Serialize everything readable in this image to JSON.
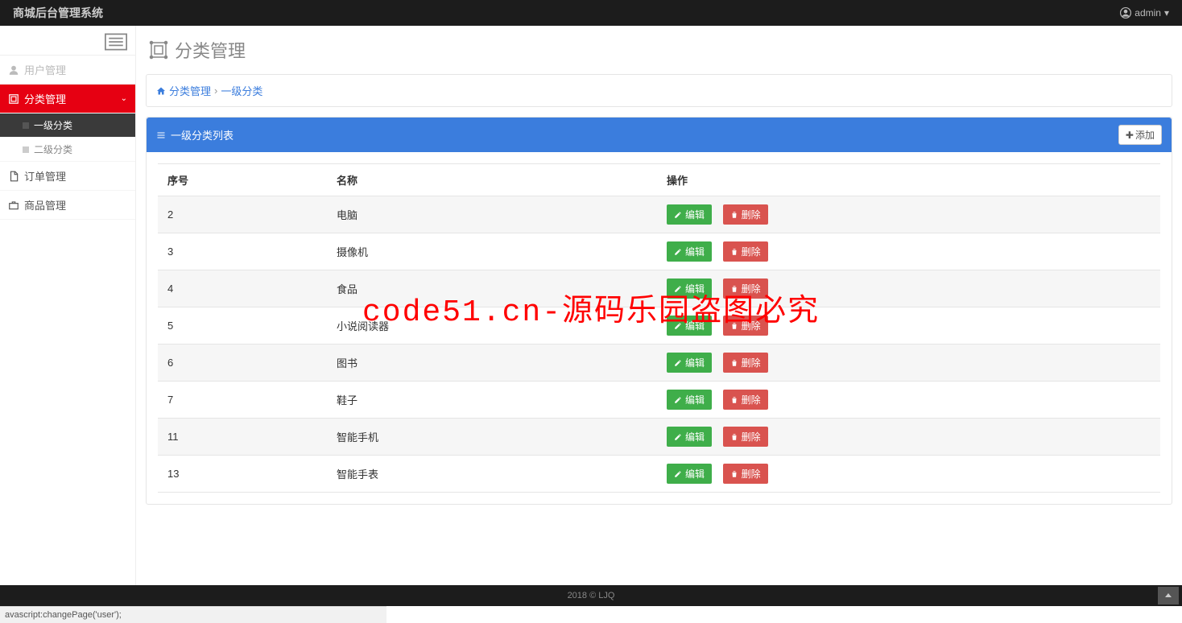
{
  "topbar": {
    "brand": "商城后台管理系统",
    "user": "admin"
  },
  "sidebar": {
    "items": [
      {
        "label": "用户管理",
        "kind": "muted"
      },
      {
        "label": "分类管理",
        "kind": "active"
      },
      {
        "label": "订单管理",
        "kind": "normal"
      },
      {
        "label": "商品管理",
        "kind": "normal"
      }
    ],
    "subitems": [
      {
        "label": "一级分类",
        "selected": true
      },
      {
        "label": "二级分类",
        "selected": false
      }
    ]
  },
  "page": {
    "title": "分类管理"
  },
  "breadcrumb": {
    "a": "分类管理",
    "b": "一级分类"
  },
  "panel": {
    "title": "一级分类列表",
    "add_label": "添加"
  },
  "table": {
    "headers": {
      "id": "序号",
      "name": "名称",
      "actions": "操作"
    },
    "actions": {
      "edit": "编辑",
      "delete": "删除"
    },
    "rows": [
      {
        "id": "2",
        "name": "电脑"
      },
      {
        "id": "3",
        "name": "摄像机"
      },
      {
        "id": "4",
        "name": "食品"
      },
      {
        "id": "5",
        "name": "小说阅读器"
      },
      {
        "id": "6",
        "name": "图书"
      },
      {
        "id": "7",
        "name": "鞋子"
      },
      {
        "id": "11",
        "name": "智能手机"
      },
      {
        "id": "13",
        "name": "智能手表"
      }
    ]
  },
  "footer": {
    "text": "2018 © LJQ"
  },
  "statusbar": {
    "text": "avascript:changePage('user');"
  },
  "watermark": "code51.cn-源码乐园盗图必究"
}
